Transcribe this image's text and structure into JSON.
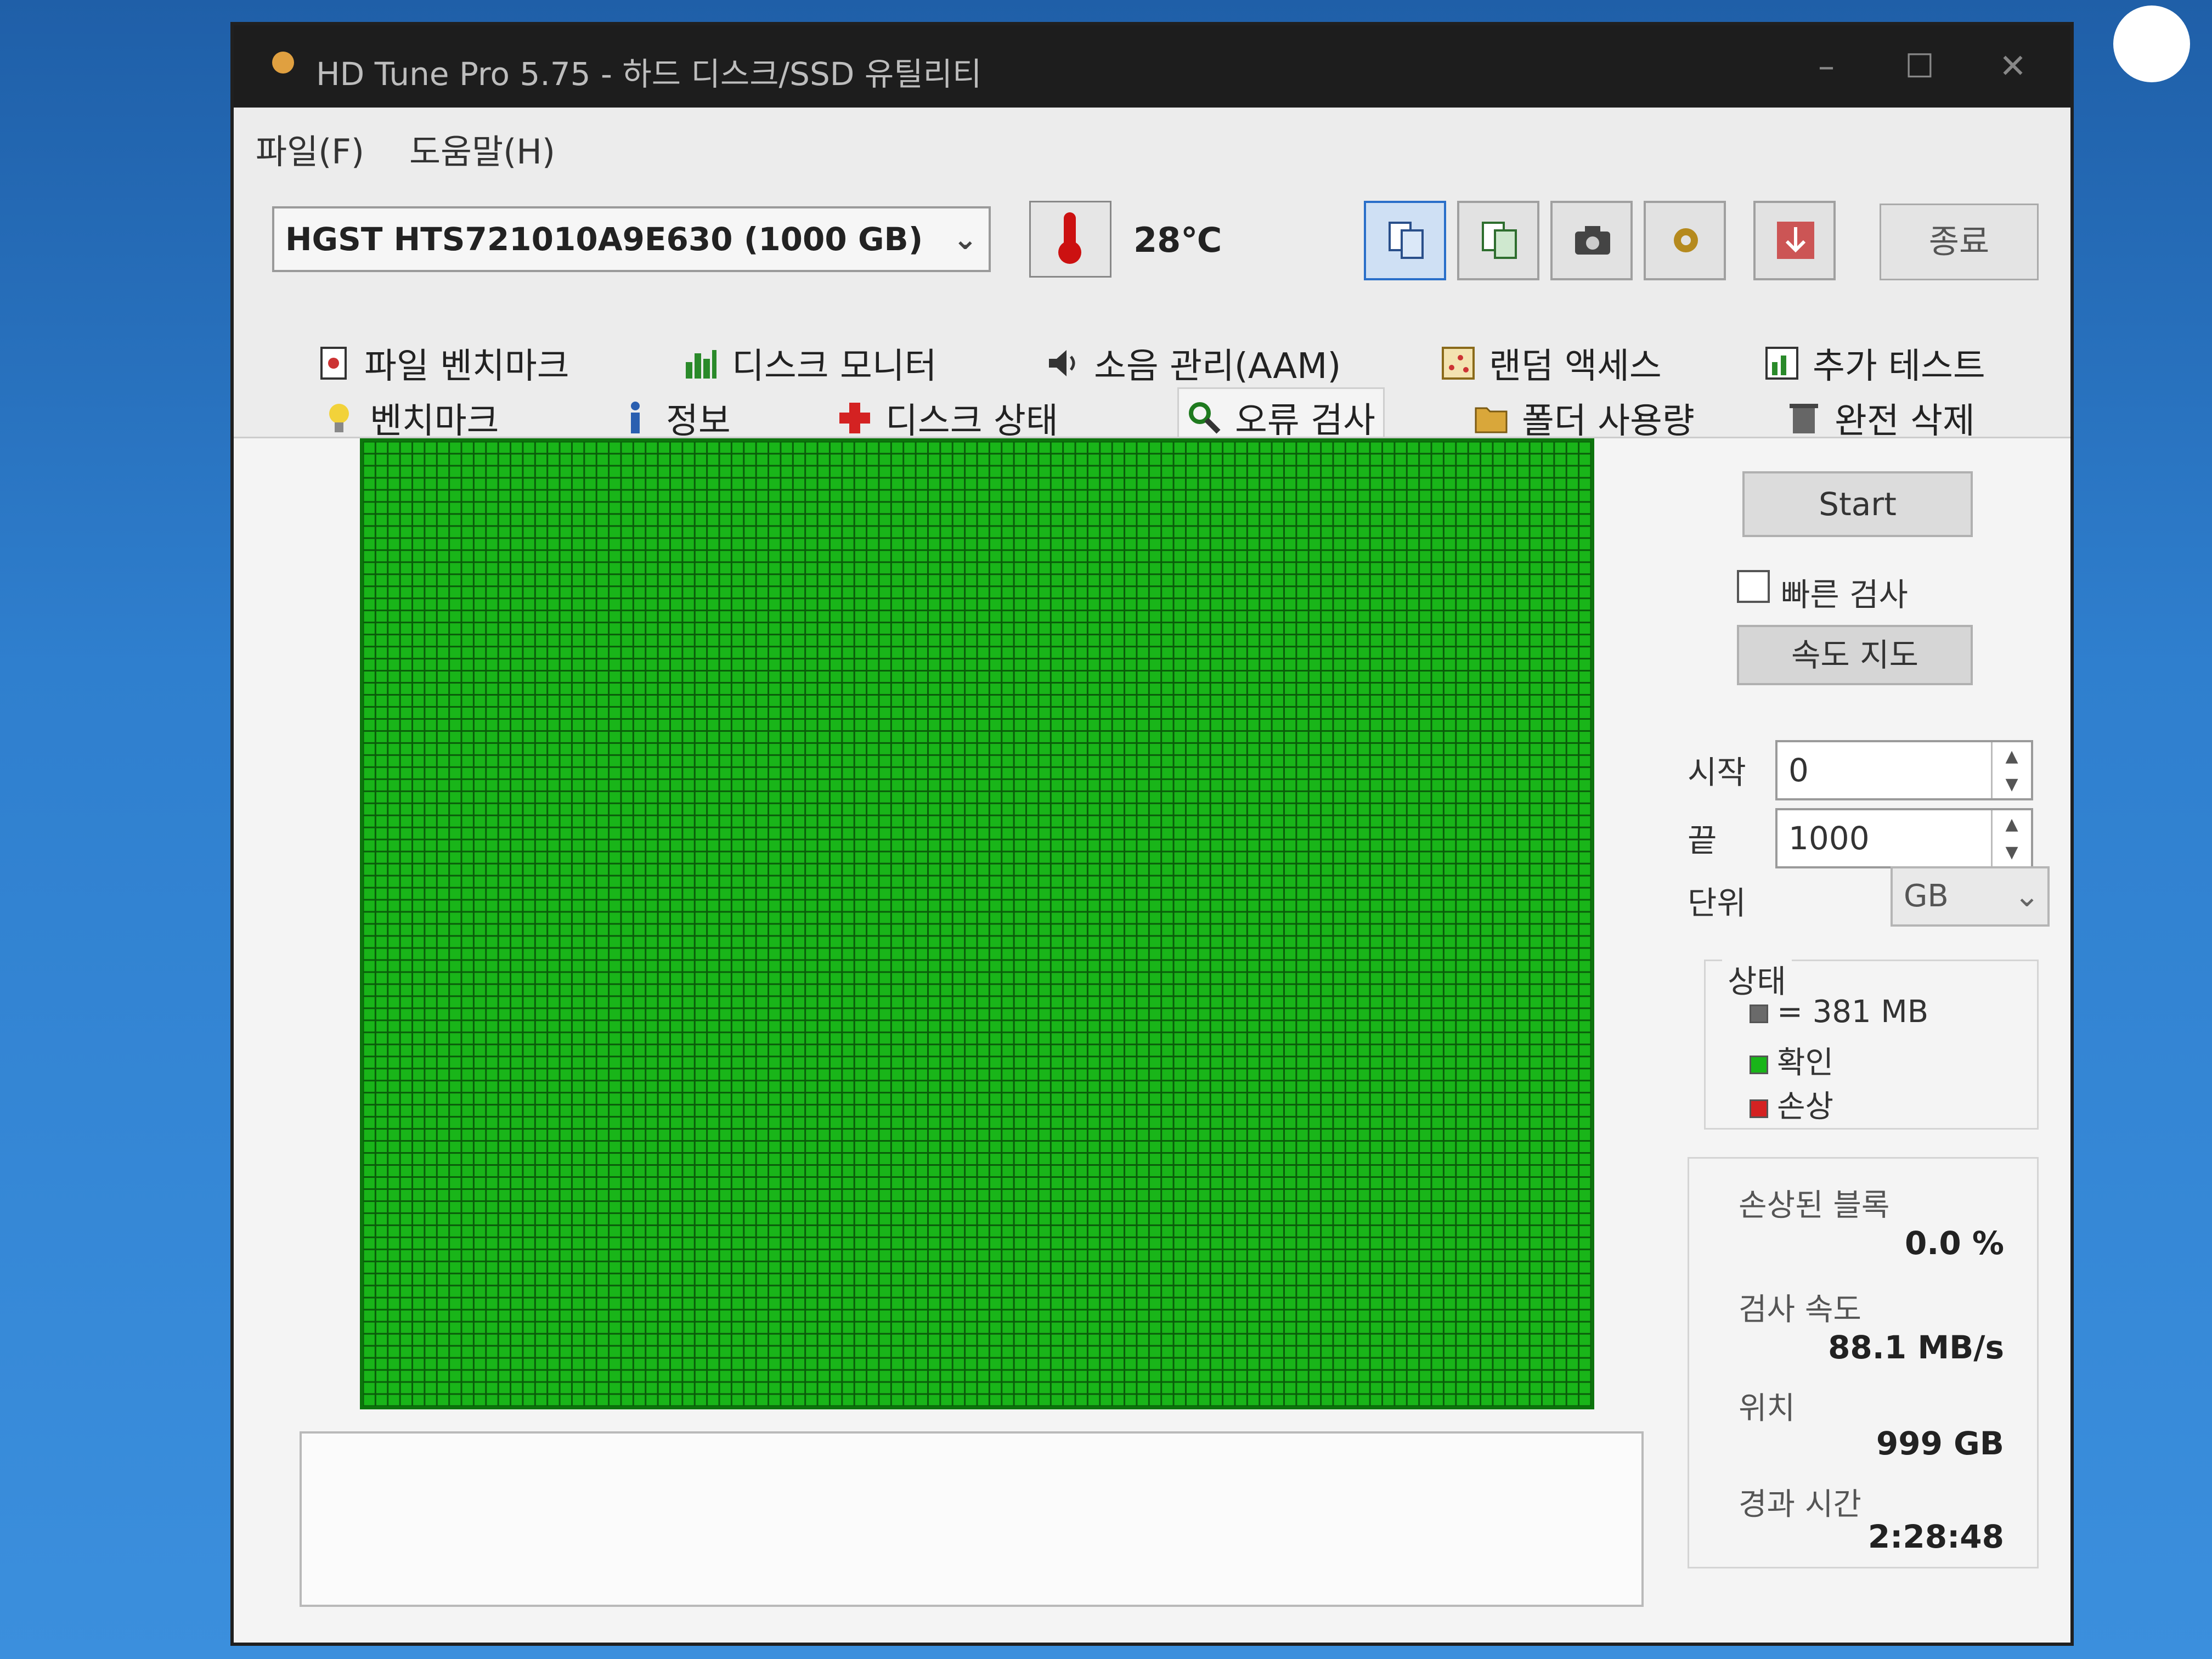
{
  "window": {
    "title": "HD Tune Pro 5.75 - 하드 디스크/SSD 유틸리티",
    "min_symbol": "–",
    "max_symbol": "☐",
    "close_symbol": "✕"
  },
  "menu": {
    "file": "파일(F)",
    "help": "도움말(H)"
  },
  "toolbar": {
    "drive": "HGST HTS721010A9E630 (1000 GB)",
    "temperature": "28℃",
    "exit_label": "종료",
    "icons": [
      "copy-text-icon",
      "copy-image-icon",
      "camera-icon",
      "settings-icon",
      "download-icon"
    ]
  },
  "tabs": {
    "row1": [
      "파일 벤치마크",
      "디스크 모니터",
      "소음 관리(AAM)",
      "랜덤 액세스",
      "추가 테스트"
    ],
    "row2": [
      "벤치마크",
      "정보",
      "디스크 상태",
      "오류 검사",
      "폴더 사용량",
      "완전 삭제"
    ],
    "active": "오류 검사"
  },
  "error_scan": {
    "start_button": "Start",
    "quick_scan_label": "빠른 검사",
    "quick_scan_checked": false,
    "speed_map_button": "속도 지도",
    "start_label": "시작",
    "start_value": "0",
    "end_label": "끝",
    "end_value": "1000",
    "unit_label": "단위",
    "unit_value": "GB",
    "legend_title": "상태",
    "legend": [
      {
        "label": "= 381 MB",
        "color": "#6a6a6a"
      },
      {
        "label": "확인",
        "color": "#19b519"
      },
      {
        "label": "손상",
        "color": "#d42222"
      }
    ],
    "damaged_blocks_label": "손상된 블록",
    "damaged_blocks_value": "0.0 %",
    "scan_speed_label": "검사 속도",
    "scan_speed_value": "88.1 MB/s",
    "position_label": "위치",
    "position_value": "999 GB",
    "elapsed_label": "경과 시간",
    "elapsed_value": "2:28:48",
    "block_state": "all-ok",
    "block_color": "#19b519"
  }
}
